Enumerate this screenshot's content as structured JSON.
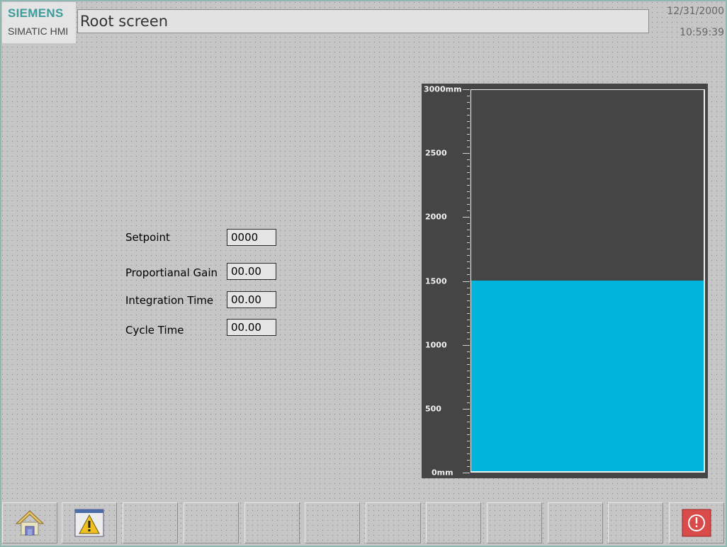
{
  "header": {
    "brand": "SIEMENS",
    "product": "SIMATIC HMI",
    "title": "Root screen",
    "date": "12/31/2000",
    "time": "10:59:39"
  },
  "params": [
    {
      "label": "Setpoint",
      "value": "0000"
    },
    {
      "label": "Proportianal Gain",
      "value": "00.00"
    },
    {
      "label": "Integration Time",
      "value": "00.00"
    },
    {
      "label": "Cycle Time",
      "value": "00.00"
    }
  ],
  "level_gauge": {
    "min": 0,
    "max": 3000,
    "value": 1500,
    "scale_labels": [
      "3000mm",
      "2500",
      "2000",
      "1500",
      "1000",
      "500",
      "0mm"
    ],
    "fill_color": "#00b4dc",
    "background_color": "#454545"
  },
  "chart_data": {
    "type": "bar",
    "categories": [
      ""
    ],
    "values": [
      1500
    ],
    "ylim": [
      0,
      3000
    ],
    "tick_labels": [
      "0mm",
      "500",
      "1000",
      "1500",
      "2000",
      "2500",
      "3000mm"
    ]
  },
  "function_keys": {
    "icons": [
      "home-icon",
      "alarm-warning-icon",
      "",
      "",
      "",
      "",
      "",
      "",
      "",
      "",
      "",
      "stop-icon"
    ],
    "stop_color": "#d94b4b"
  }
}
